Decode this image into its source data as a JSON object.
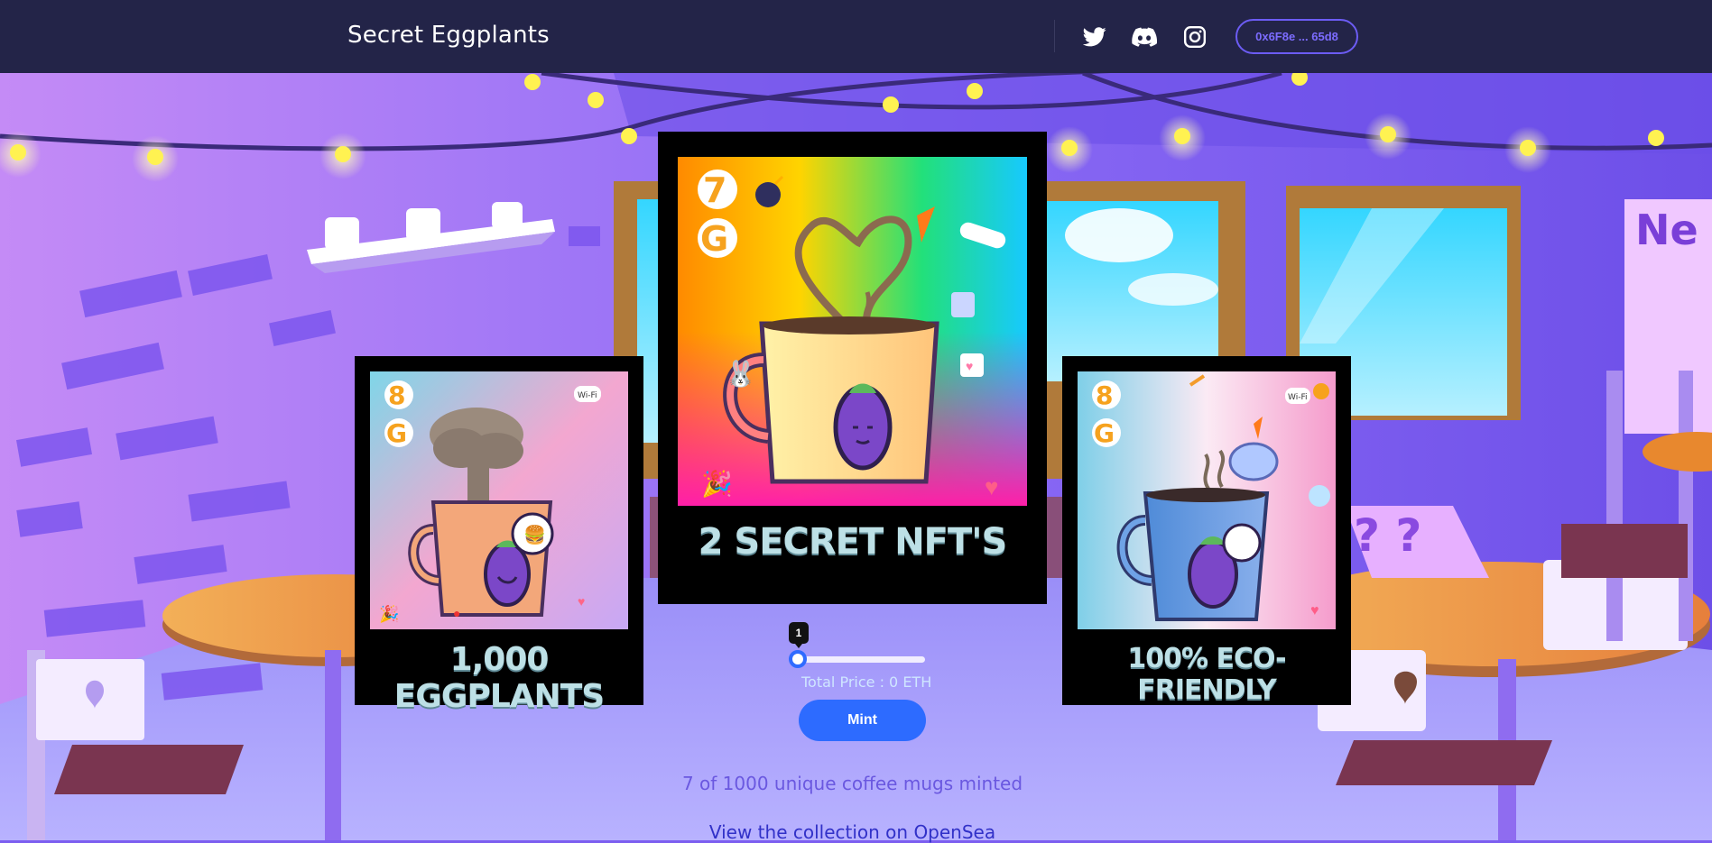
{
  "header": {
    "title": "Secret Eggplants",
    "social": [
      {
        "icon": "twitter-icon"
      },
      {
        "icon": "discord-icon"
      },
      {
        "icon": "instagram-icon"
      }
    ],
    "wallet_label": "0x6F8e ... 65d8"
  },
  "cards": {
    "left": {
      "badge": "8G",
      "caption": "1,000 EGGPLANTS"
    },
    "center": {
      "badge": "7G",
      "caption": "2 SECRET NFT'S"
    },
    "right": {
      "badge": "8G",
      "caption": "100% ECO-FRIENDLY"
    }
  },
  "mint": {
    "quantity": "1",
    "slider_fraction": 0,
    "total_price": "Total Price : 0 ETH",
    "button_label": "Mint"
  },
  "footer": {
    "minted_text": "7 of 1000 unique coffee mugs minted",
    "opensea_link": "View the collection on OpenSea"
  },
  "colors": {
    "header_bg": "#232448",
    "accent": "#2d6bff",
    "wallet_border": "#6c5cf4"
  }
}
